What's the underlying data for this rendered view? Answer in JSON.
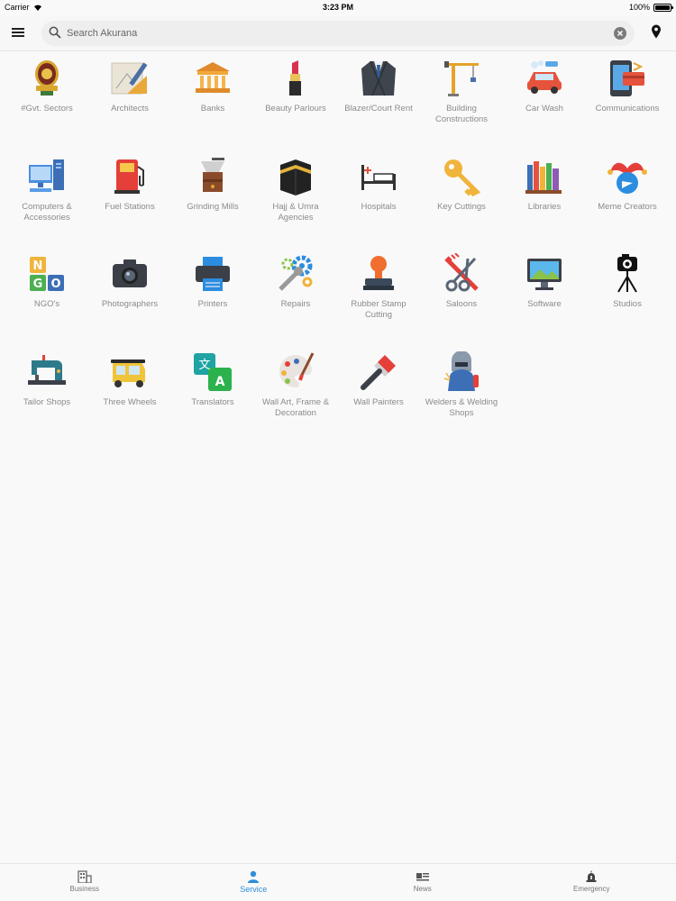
{
  "status_bar": {
    "carrier": "Carrier",
    "time": "3:23 PM",
    "battery": "100%"
  },
  "search": {
    "placeholder": "Search Akurana",
    "value": ""
  },
  "categories": [
    {
      "label": "#Gvt. Sectors",
      "icon": "emblem-icon"
    },
    {
      "label": "Architects",
      "icon": "blueprint-icon"
    },
    {
      "label": "Banks",
      "icon": "bank-icon"
    },
    {
      "label": "Beauty Parlours",
      "icon": "lipstick-icon"
    },
    {
      "label": "Blazer/Court Rent",
      "icon": "blazer-icon"
    },
    {
      "label": "Building Constructions",
      "icon": "crane-icon"
    },
    {
      "label": "Car Wash",
      "icon": "car-wash-icon"
    },
    {
      "label": "Communications",
      "icon": "phone-card-icon"
    },
    {
      "label": "Computers & Accessories",
      "icon": "computer-icon"
    },
    {
      "label": "Fuel Stations",
      "icon": "fuel-pump-icon"
    },
    {
      "label": "Grinding Mills",
      "icon": "grinder-icon"
    },
    {
      "label": "Hajj & Umra Agencies",
      "icon": "kaaba-icon"
    },
    {
      "label": "Hospitals",
      "icon": "hospital-bed-icon"
    },
    {
      "label": "Key Cuttings",
      "icon": "key-icon"
    },
    {
      "label": "Libraries",
      "icon": "books-icon"
    },
    {
      "label": "Meme Creators",
      "icon": "jester-icon"
    },
    {
      "label": "NGO's",
      "icon": "ngo-blocks-icon"
    },
    {
      "label": "Photographers",
      "icon": "camera-icon"
    },
    {
      "label": "Printers",
      "icon": "printer-icon"
    },
    {
      "label": "Repairs",
      "icon": "gears-wrench-icon"
    },
    {
      "label": "Rubber Stamp Cutting",
      "icon": "rubber-stamp-icon"
    },
    {
      "label": "Saloons",
      "icon": "scissors-comb-icon"
    },
    {
      "label": "Software",
      "icon": "monitor-icon"
    },
    {
      "label": "Studios",
      "icon": "tripod-camera-icon"
    },
    {
      "label": "Tailor Shops",
      "icon": "sewing-machine-icon"
    },
    {
      "label": "Three Wheels",
      "icon": "tuk-tuk-icon"
    },
    {
      "label": "Translators",
      "icon": "translate-icon"
    },
    {
      "label": "Wall Art, Frame & Decoration",
      "icon": "palette-icon"
    },
    {
      "label": "Wall Painters",
      "icon": "paint-brush-icon"
    },
    {
      "label": "Welders & Welding Shops",
      "icon": "welder-icon"
    }
  ],
  "tabs": [
    {
      "label": "Business",
      "icon": "building-icon"
    },
    {
      "label": "Service",
      "icon": "person-icon",
      "active": true
    },
    {
      "label": "News",
      "icon": "news-icon"
    },
    {
      "label": "Emergency",
      "icon": "alarm-icon"
    }
  ],
  "colors": {
    "accent": "#2f8ed8",
    "label": "#8b8b8b",
    "background": "#f9f9fa"
  }
}
